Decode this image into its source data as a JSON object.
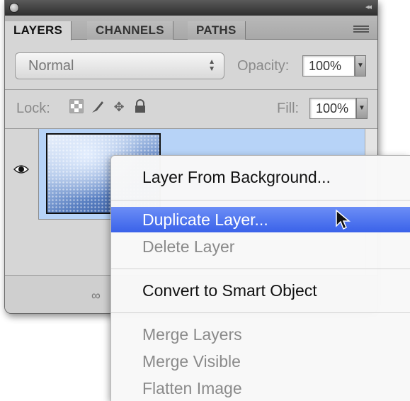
{
  "panel": {
    "tabs": [
      {
        "label": "LAYERS",
        "active": true
      },
      {
        "label": "CHANNELS",
        "active": false
      },
      {
        "label": "PATHS",
        "active": false
      }
    ],
    "blend_mode": "Normal",
    "opacity_label": "Opacity:",
    "opacity_value": "100%",
    "lock_label": "Lock:",
    "fill_label": "Fill:",
    "fill_value": "100%",
    "icons": [
      "close-icon",
      "collapse-icon",
      "panel-menu-icon",
      "select-arrows-icon",
      "lock-transparent-icon",
      "lock-image-icon",
      "lock-position-icon",
      "lock-all-icon",
      "eye-icon",
      "link-layers-icon"
    ]
  },
  "menu": {
    "items": [
      {
        "label": "Layer From Background...",
        "state": "enabled"
      },
      {
        "label": "Duplicate Layer...",
        "state": "highlighted"
      },
      {
        "label": "Delete Layer",
        "state": "disabled"
      },
      {
        "label": "Convert to Smart Object",
        "state": "enabled"
      },
      {
        "label": "Merge Layers",
        "state": "disabled"
      },
      {
        "label": "Merge Visible",
        "state": "disabled"
      },
      {
        "label": "Flatten Image",
        "state": "disabled"
      }
    ]
  },
  "colors": {
    "panel_bg": "#d6d6d6",
    "selected_layer": "#b7d3f7",
    "menu_highlight": "#3a62e9",
    "disabled_text": "#8a8a8a"
  }
}
